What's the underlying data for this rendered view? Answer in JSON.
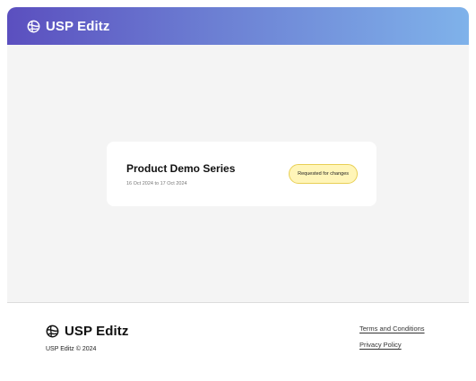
{
  "header": {
    "brand_name": "USP Editz",
    "logo_icon": "globe-logo-icon",
    "gradient": [
      "#5b4fbf",
      "#7fb2ea"
    ]
  },
  "project_card": {
    "title": "Product Demo Series",
    "dates": "16 Oct 2024 to 17 Oct 2024",
    "status": "Requested for changes",
    "status_color": "#fff5b8"
  },
  "footer": {
    "brand_name": "USP Editz",
    "copyright": "USP Editz © 2024",
    "links": [
      "Terms and Conditions",
      "Privacy Policy"
    ]
  }
}
